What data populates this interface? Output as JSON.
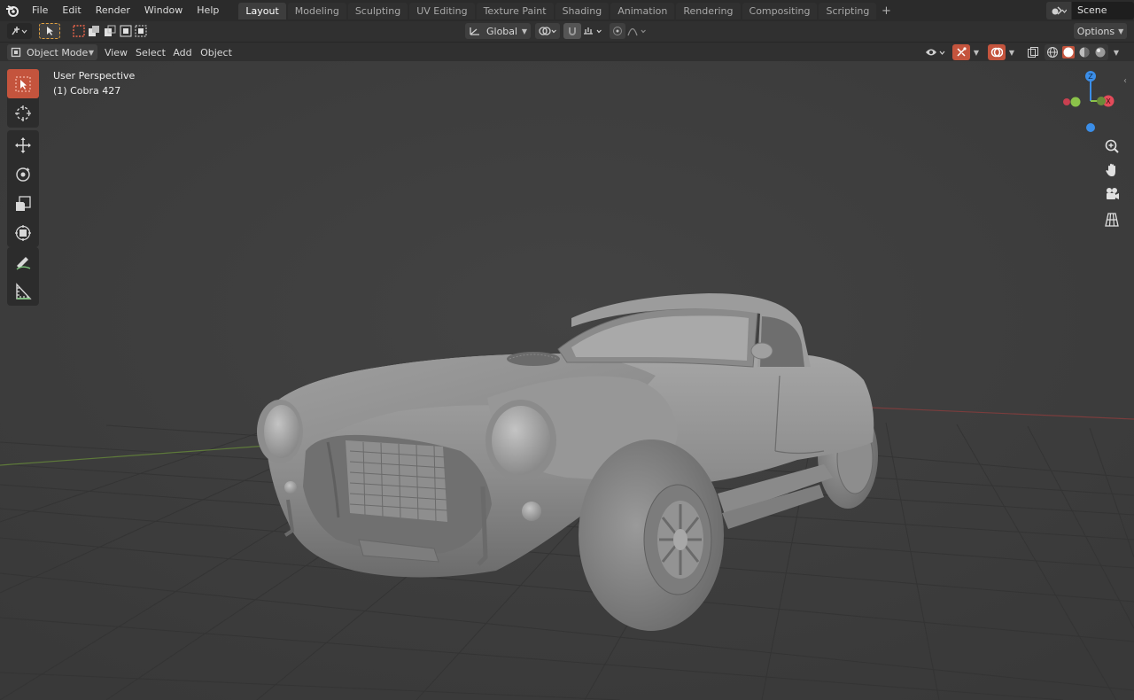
{
  "topbar": {
    "menus": [
      "File",
      "Edit",
      "Render",
      "Window",
      "Help"
    ],
    "workspaces": [
      "Layout",
      "Modeling",
      "Sculpting",
      "UV Editing",
      "Texture Paint",
      "Shading",
      "Animation",
      "Rendering",
      "Compositing",
      "Scripting"
    ],
    "active_workspace": "Layout",
    "add_tab": "+",
    "scene_name": "Scene"
  },
  "tool_header": {
    "transform_orientation": "Global",
    "options_label": "Options"
  },
  "view_header": {
    "mode": "Object Mode",
    "menus": [
      "View",
      "Select",
      "Add",
      "Object"
    ]
  },
  "viewport": {
    "perspective_label": "User Perspective",
    "object_label": "(1) Cobra 427"
  },
  "gizmo": {
    "z_label": "Z",
    "x_label": "X"
  },
  "colors": {
    "accent": "#c4543d",
    "x_axis": "#e34b5a",
    "y_axis": "#8bc34a",
    "z_axis": "#3b8ee8"
  }
}
